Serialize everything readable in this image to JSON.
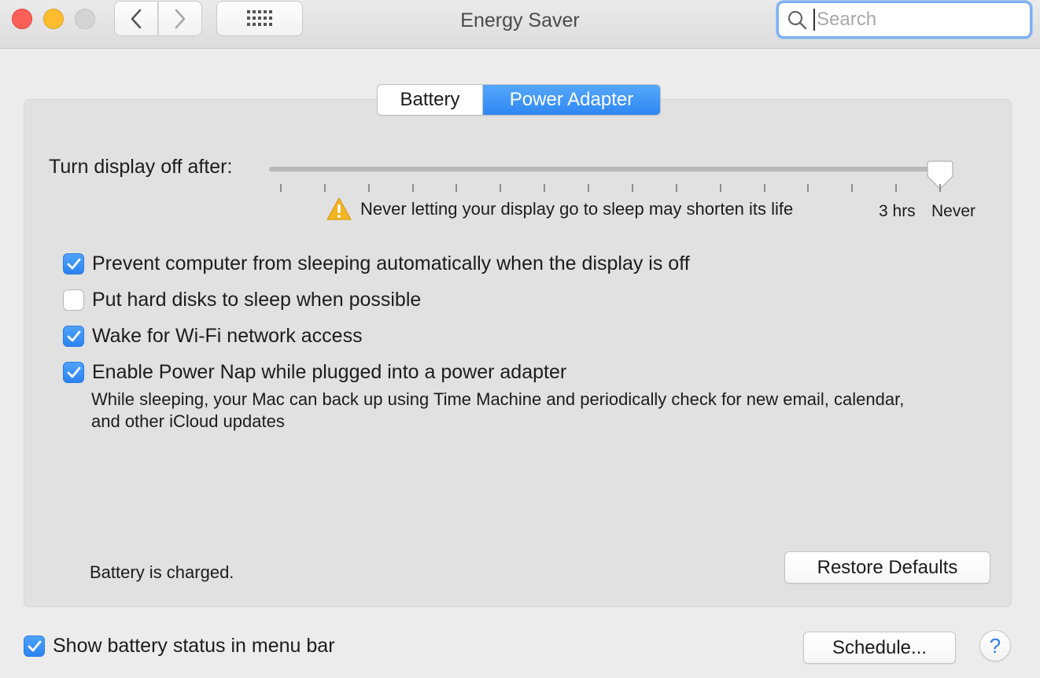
{
  "window": {
    "title": "Energy Saver"
  },
  "toolbar": {
    "back_icon": "chevron-left-icon",
    "forward_icon": "chevron-right-icon",
    "grid_icon": "grid-icon",
    "search_placeholder": "Search",
    "search_value": ""
  },
  "tabs": [
    {
      "label": "Battery",
      "selected": false
    },
    {
      "label": "Power Adapter",
      "selected": true
    }
  ],
  "display_sleep": {
    "label": "Turn display off after:",
    "warning": "Never letting your display go to sleep may shorten its life",
    "mid_label": "3 hrs",
    "end_label": "Never",
    "selected_value": "Never",
    "tick_count": 16
  },
  "options": [
    {
      "label": "Prevent computer from sleeping automatically when the display is off",
      "checked": true
    },
    {
      "label": "Put hard disks to sleep when possible",
      "checked": false
    },
    {
      "label": "Wake for Wi-Fi network access",
      "checked": true
    },
    {
      "label": "Enable Power Nap while plugged into a power adapter",
      "checked": true
    }
  ],
  "power_nap_description": "While sleeping, your Mac can back up using Time Machine and periodically check for new email, calendar, and other iCloud updates",
  "status_text": "Battery is charged.",
  "buttons": {
    "restore_defaults": "Restore Defaults",
    "schedule": "Schedule...",
    "help": "?"
  },
  "footer": {
    "show_battery_status": {
      "label": "Show battery status in menu bar",
      "checked": true
    }
  },
  "colors": {
    "accent": "#3b8ff6",
    "close": "#fc5f57",
    "minimize": "#fdbc2e",
    "zoom_disabled": "#d4d4d4",
    "warning": "#f2b524"
  }
}
